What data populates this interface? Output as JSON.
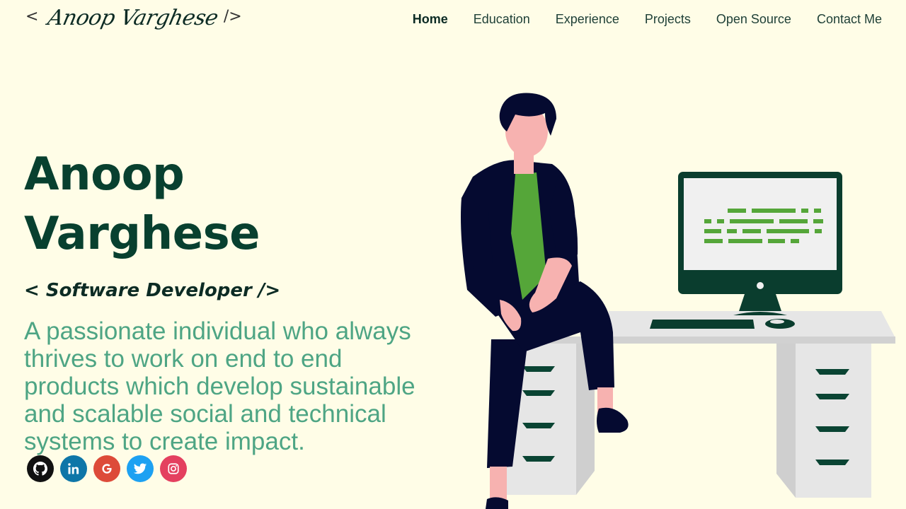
{
  "header": {
    "logo": {
      "open": "<",
      "signature": "Anoop Varghese",
      "close": "/>"
    },
    "nav": [
      {
        "label": "Home",
        "active": true
      },
      {
        "label": "Education"
      },
      {
        "label": "Experience"
      },
      {
        "label": "Projects"
      },
      {
        "label": "Open Source"
      },
      {
        "label": "Contact Me"
      }
    ]
  },
  "hero": {
    "name": "Anoop Varghese",
    "role": "< Software Developer />",
    "description": "A passionate individual who always thrives to work on end to end products which develop sustainable and scalable social and technical systems to create impact."
  },
  "socials": [
    {
      "icon": "github-icon",
      "color": "#111111"
    },
    {
      "icon": "linkedin-icon",
      "color": "#0e76a8"
    },
    {
      "icon": "google-icon",
      "color": "#dd4b39"
    },
    {
      "icon": "twitter-icon",
      "color": "#1da1f2"
    },
    {
      "icon": "instagram-icon",
      "color": "#e4405f"
    }
  ],
  "colors": {
    "background": "#fffde7",
    "name": "#08402f",
    "description": "#4ea584",
    "accent_green": "#55a639",
    "dark": "#050a30"
  }
}
